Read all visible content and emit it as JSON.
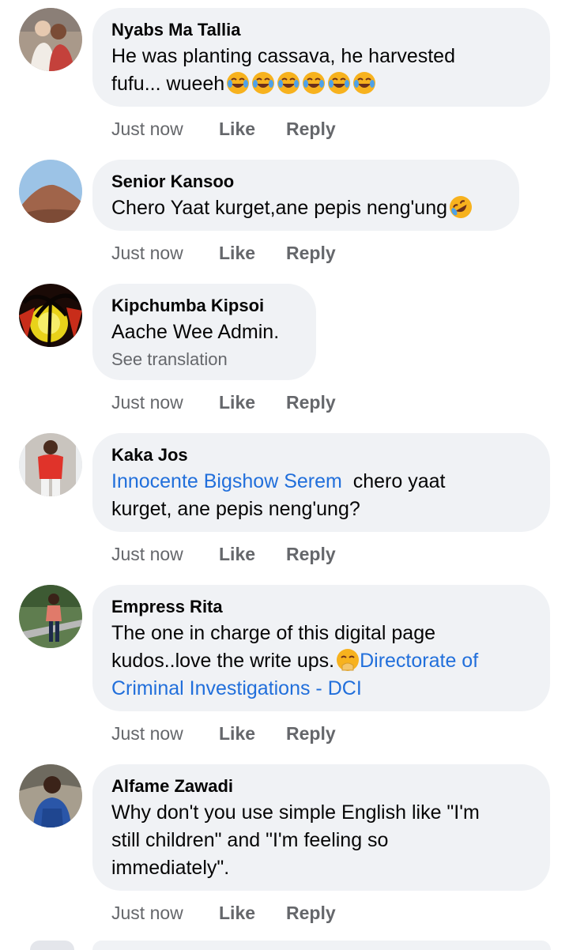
{
  "comments": [
    {
      "author": "Nyabs Ma Tallia",
      "line1": "He was planting cassava, he harvested",
      "line2": "fufu... wueeh",
      "emoji": "face-with-tears-of-joy",
      "time": "Just now",
      "like": "Like",
      "reply": "Reply"
    },
    {
      "author": "Senior Kansoo",
      "line1": "Chero Yaat kurget,ane pepis neng'ung",
      "emoji": "rolling-on-floor-laughing",
      "time": "Just now",
      "like": "Like",
      "reply": "Reply"
    },
    {
      "author": "Kipchumba Kipsoi",
      "line1": "Aache Wee Admin.",
      "see_translation": "See translation",
      "time": "Just now",
      "like": "Like",
      "reply": "Reply"
    },
    {
      "author": "Kaka Jos",
      "mention": "Innocente Bigshow Serem",
      "line1_rest": "  chero yaat",
      "line2": "kurget, ane pepis neng'ung?",
      "time": "Just now",
      "like": "Like",
      "reply": "Reply"
    },
    {
      "author": "Empress Rita",
      "line1": "The one in charge of this digital page",
      "line2": "kudos..love the write ups.",
      "emoji": "face-with-hand-over-mouth",
      "mention_a": "Directorate of",
      "mention_b": "Criminal Investigations - DCI",
      "time": "Just now",
      "like": "Like",
      "reply": "Reply"
    },
    {
      "author": "Alfame Zawadi",
      "line1": "Why don't you use simple English like \"I'm",
      "line2": "still children\" and \"I'm feeling so",
      "line3": "immediately\".",
      "time": "Just now",
      "like": "Like",
      "reply": "Reply"
    }
  ],
  "colors": {
    "bubble": "#f0f2f5",
    "link": "#216fdb",
    "meta": "#65676b"
  }
}
